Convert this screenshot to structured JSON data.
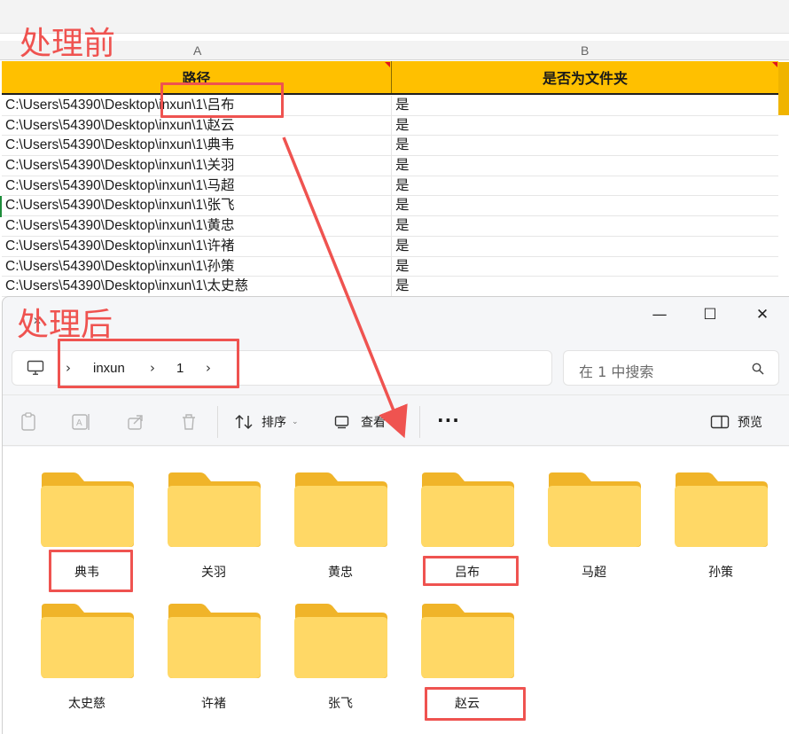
{
  "annotations": {
    "before_label": "处理前",
    "after_label": "处理后"
  },
  "sheet": {
    "columns": [
      "A",
      "B"
    ],
    "headers": [
      "路径",
      "是否为文件夹"
    ],
    "rows": [
      [
        "C:\\Users\\54390\\Desktop\\inxun\\1\\吕布",
        "是"
      ],
      [
        "C:\\Users\\54390\\Desktop\\inxun\\1\\赵云",
        "是"
      ],
      [
        "C:\\Users\\54390\\Desktop\\inxun\\1\\典韦",
        "是"
      ],
      [
        "C:\\Users\\54390\\Desktop\\inxun\\1\\关羽",
        "是"
      ],
      [
        "C:\\Users\\54390\\Desktop\\inxun\\1\\马超",
        "是"
      ],
      [
        "C:\\Users\\54390\\Desktop\\inxun\\1\\张飞",
        "是"
      ],
      [
        "C:\\Users\\54390\\Desktop\\inxun\\1\\黄忠",
        "是"
      ],
      [
        "C:\\Users\\54390\\Desktop\\inxun\\1\\许褚",
        "是"
      ],
      [
        "C:\\Users\\54390\\Desktop\\inxun\\1\\孙策",
        "是"
      ],
      [
        "C:\\Users\\54390\\Desktop\\inxun\\1\\太史慈",
        "是"
      ]
    ],
    "header_color": "#ffc000"
  },
  "explorer": {
    "window_buttons": {
      "minimize": "—",
      "maximize": "☐",
      "close": "✕"
    },
    "breadcrumb": [
      "inxun",
      "1"
    ],
    "search_placeholder": "在 1 中搜索",
    "toolbar": {
      "sort_label": "排序",
      "view_label": "查看",
      "more_label": "···",
      "preview_label": "预览"
    },
    "folders": [
      "典韦",
      "关羽",
      "黄忠",
      "吕布",
      "马超",
      "孙策",
      "太史慈",
      "许褚",
      "张飞",
      "赵云"
    ],
    "icons": [
      "monitor-icon",
      "clipboard-icon",
      "rename-icon",
      "share-icon",
      "trash-icon",
      "sort-icon",
      "view-icon",
      "preview-icon",
      "search-icon"
    ],
    "colors": {
      "folder_back": "#f0b429",
      "folder_front": "#ffd866",
      "annotation_red": "#ef5350"
    }
  }
}
